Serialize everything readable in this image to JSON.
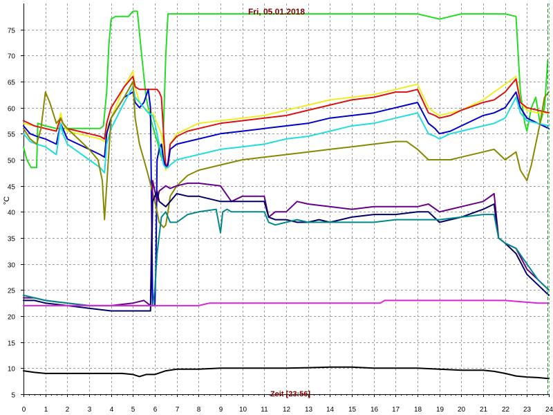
{
  "chart_data": {
    "type": "line",
    "title": "Fri, 05.01.2018",
    "xlabel": "Zeit [23:56]",
    "ylabel": "°C",
    "xlim": [
      0,
      24
    ],
    "ylim": [
      5,
      80
    ],
    "xticks": [
      0,
      1,
      2,
      3,
      4,
      5,
      6,
      7,
      8,
      9,
      10,
      11,
      12,
      13,
      14,
      15,
      16,
      17,
      18,
      19,
      20,
      21,
      22,
      23,
      24
    ],
    "yticks": [
      5,
      10,
      15,
      20,
      25,
      30,
      35,
      40,
      45,
      50,
      55,
      60,
      65,
      70,
      75
    ],
    "grid": true,
    "now_marker_x": 23.93,
    "series": [
      {
        "color": "#22dd22",
        "x": [
          0,
          0.15,
          0.35,
          0.6,
          0.65,
          1.0,
          1.5,
          2.0,
          2.5,
          3.0,
          3.5,
          3.65,
          3.8,
          3.9,
          4.0,
          4.2,
          4.5,
          4.8,
          5.0,
          5.1,
          5.2,
          5.4,
          5.6,
          5.8,
          6.0,
          6.15,
          6.25,
          6.35,
          6.5,
          6.6,
          6.7,
          7.0,
          7.5,
          8.0,
          9.0,
          10.0,
          11.0,
          12.0,
          13.0,
          14.0,
          15.0,
          16.0,
          17.0,
          18.0,
          18.5,
          19.0,
          19.5,
          20.0,
          21.0,
          22.0,
          22.5,
          22.7,
          22.9,
          23.0,
          23.2,
          23.4,
          23.6,
          23.8,
          23.95
        ],
        "y": [
          52.5,
          50,
          48.5,
          48.5,
          57,
          56.5,
          56,
          56,
          56,
          56,
          56,
          56.5,
          63,
          72,
          77,
          77.5,
          77.5,
          77.5,
          78.5,
          78.5,
          78.5,
          70,
          62,
          58,
          55,
          53,
          51,
          50,
          70,
          78,
          78,
          78,
          78,
          78,
          78,
          78,
          78,
          78,
          78,
          78,
          78,
          78,
          78,
          78,
          77.5,
          77,
          77.5,
          78,
          78,
          78,
          77.5,
          63,
          57,
          55.5,
          60,
          62,
          57,
          60,
          69
        ]
      },
      {
        "color": "#eeee22",
        "x": [
          0,
          0.5,
          1.0,
          1.5,
          1.7,
          1.8,
          2.0,
          2.5,
          3.0,
          3.5,
          3.7,
          3.8,
          4.0,
          4.3,
          4.6,
          5.0,
          5.1,
          5.3,
          5.5,
          5.7,
          5.9,
          6.0,
          6.1,
          6.2,
          6.3,
          6.4,
          6.5,
          6.6,
          6.7,
          7.0,
          7.5,
          8.0,
          9.0,
          10.0,
          11.0,
          12.0,
          13.0,
          14.0,
          15.0,
          16.0,
          17.0,
          17.5,
          18.0,
          18.5,
          18.8,
          19.0,
          19.5,
          20.0,
          21.0,
          21.5,
          22.0,
          22.5,
          22.7,
          23.0,
          23.5,
          24.0
        ],
        "y": [
          57,
          56.5,
          56,
          55.5,
          59,
          57,
          55.5,
          55,
          54.5,
          54,
          53.5,
          56,
          58,
          61,
          64,
          67,
          64,
          61,
          60,
          59.5,
          59,
          58,
          57,
          56,
          55,
          52,
          48,
          49,
          53,
          55,
          56,
          57,
          57.5,
          58,
          58.5,
          59.5,
          60.5,
          61.5,
          62,
          62.5,
          63.5,
          64,
          64.5,
          60,
          59,
          58.5,
          59,
          59.5,
          61.5,
          63,
          64.5,
          66,
          61,
          59.5,
          59,
          59
        ]
      },
      {
        "color": "#dd1111",
        "x": [
          0,
          0.5,
          1.0,
          1.5,
          1.7,
          1.8,
          2.0,
          2.5,
          3.0,
          3.5,
          3.7,
          3.8,
          4.0,
          4.3,
          4.6,
          5.0,
          5.1,
          5.3,
          5.5,
          5.7,
          5.9,
          6.0,
          6.1,
          6.2,
          6.3,
          6.4,
          6.5,
          6.6,
          6.7,
          7.0,
          7.5,
          8.0,
          9.0,
          10.0,
          11.0,
          12.0,
          13.0,
          14.0,
          15.0,
          16.0,
          17.0,
          17.5,
          18.0,
          18.5,
          18.8,
          19.0,
          19.5,
          20.0,
          21.0,
          21.5,
          22.0,
          22.5,
          22.7,
          23.0,
          23.5,
          24.0
        ],
        "y": [
          57.5,
          56.5,
          56,
          55.5,
          58,
          57,
          56,
          55.5,
          55,
          54.5,
          54,
          57,
          60,
          62,
          64,
          66,
          64,
          63.5,
          63.5,
          63.5,
          63.5,
          63.5,
          63.5,
          63,
          62,
          55,
          48.5,
          49.5,
          53,
          54.5,
          55.5,
          56,
          57,
          57.5,
          58,
          58.5,
          59.5,
          60.5,
          61.5,
          62,
          63,
          63,
          63.5,
          59,
          58.5,
          58,
          58.5,
          59.5,
          61,
          61.5,
          63,
          65.5,
          61,
          60,
          59.5,
          59
        ]
      },
      {
        "color": "#0000cc",
        "x": [
          0,
          0.3,
          0.6,
          1.0,
          1.5,
          1.7,
          1.8,
          2.0,
          2.5,
          3.0,
          3.5,
          3.7,
          3.8,
          4.0,
          4.3,
          4.6,
          5.0,
          5.1,
          5.3,
          5.5,
          5.7,
          5.8,
          5.85,
          5.9,
          6.0,
          6.05,
          6.1,
          6.2,
          6.3,
          6.4,
          6.5,
          6.6,
          6.7,
          7.0,
          7.5,
          8.0,
          9.0,
          10.0,
          11.0,
          12.0,
          13.0,
          14.0,
          15.0,
          16.0,
          17.0,
          17.5,
          18.0,
          18.5,
          18.8,
          19.0,
          19.5,
          20.0,
          21.0,
          21.5,
          22.0,
          22.5,
          22.7,
          23.0,
          23.5,
          24.0
        ],
        "y": [
          56.5,
          55,
          54.5,
          54,
          53,
          57,
          56,
          54,
          53,
          52,
          51,
          50.5,
          55,
          58,
          60,
          62,
          63,
          61,
          60,
          61,
          63.5,
          60,
          40,
          22,
          22,
          30,
          50,
          52,
          53,
          50,
          48.5,
          49,
          52,
          53,
          53.5,
          54,
          55,
          55.5,
          56,
          56.5,
          57,
          58,
          58.5,
          59,
          60,
          60.5,
          61,
          57,
          56,
          55,
          55.5,
          56.5,
          58.5,
          59,
          60,
          63,
          60,
          58,
          57,
          56
        ]
      },
      {
        "color": "#22dddd",
        "x": [
          0,
          0.3,
          0.6,
          1.0,
          1.5,
          1.7,
          1.8,
          2.0,
          2.5,
          3.0,
          3.5,
          3.7,
          3.8,
          4.0,
          4.3,
          4.6,
          5.0,
          5.1,
          5.3,
          5.5,
          5.7,
          5.9,
          6.0,
          6.2,
          6.4,
          6.5,
          6.6,
          6.7,
          7.0,
          7.5,
          8.0,
          9.0,
          10.0,
          11.0,
          12.0,
          13.0,
          14.0,
          15.0,
          16.0,
          17.0,
          17.5,
          18.0,
          18.5,
          18.8,
          19.0,
          19.5,
          20.0,
          21.0,
          21.5,
          22.0,
          22.5,
          22.7,
          23.0,
          23.5,
          24.0
        ],
        "y": [
          55,
          53.5,
          53,
          52.5,
          51,
          57,
          55,
          53,
          51.5,
          50,
          48.5,
          47.5,
          53,
          56,
          58.5,
          61,
          64,
          62,
          61,
          60,
          59,
          58.5,
          57,
          53,
          49,
          48.5,
          48.5,
          49,
          50,
          50.5,
          51,
          52,
          52.5,
          53,
          54,
          54.5,
          55.5,
          56.5,
          57,
          58,
          58.5,
          59,
          55,
          54.5,
          54,
          55,
          55.5,
          56.5,
          57,
          58,
          62,
          59,
          57.5,
          57,
          56.5
        ]
      },
      {
        "color": "#888800",
        "x": [
          0,
          0.3,
          0.6,
          0.8,
          1.0,
          1.2,
          1.5,
          1.7,
          1.8,
          2.0,
          2.5,
          3.0,
          3.4,
          3.6,
          3.7,
          3.8,
          4.0,
          4.3,
          4.6,
          5.0,
          5.1,
          5.3,
          5.5,
          5.7,
          6.0,
          6.2,
          6.4,
          6.5,
          6.6,
          6.7,
          7.0,
          7.5,
          8.0,
          9.0,
          10.0,
          11.0,
          12.0,
          13.0,
          14.0,
          15.0,
          16.0,
          17.0,
          17.5,
          18.0,
          18.5,
          19.0,
          19.5,
          20.0,
          21.0,
          21.5,
          22.0,
          22.5,
          22.7,
          23.0,
          23.2,
          23.4,
          23.6,
          23.8,
          24.0
        ],
        "y": [
          56,
          54,
          53,
          56,
          63,
          61,
          57,
          58,
          57,
          56,
          54,
          52,
          50,
          46,
          38.5,
          45,
          58,
          60,
          62,
          65,
          58,
          53,
          50,
          47,
          42,
          38,
          37,
          37.5,
          40,
          43,
          45,
          47,
          48,
          49,
          50,
          50.5,
          51,
          51.5,
          52,
          52.5,
          53,
          53.5,
          53.5,
          52,
          50,
          50,
          50,
          50.5,
          51.5,
          52,
          50,
          51.5,
          48,
          46,
          49,
          53,
          57,
          62,
          63
        ]
      },
      {
        "color": "#660088",
        "x": [
          0,
          0.5,
          1.0,
          2.0,
          3.0,
          4.0,
          5.0,
          5.5,
          5.8,
          5.85,
          5.9,
          6.0,
          6.1,
          6.2,
          6.5,
          6.7,
          7.0,
          7.5,
          8.0,
          9.0,
          9.5,
          10.0,
          11.0,
          11.2,
          11.5,
          12.0,
          12.5,
          13.0,
          14.0,
          15.0,
          16.0,
          17.0,
          18.0,
          18.5,
          19.0,
          19.5,
          20.0,
          21.0,
          21.5,
          21.7,
          22.0,
          22.5,
          23.0,
          23.5,
          24.0
        ],
        "y": [
          23.5,
          23.5,
          23,
          22.5,
          22,
          22,
          22.5,
          23,
          22,
          35,
          46,
          44,
          42,
          44,
          45,
          44.5,
          45,
          45.5,
          45.5,
          45,
          42,
          43,
          43,
          39,
          40,
          40,
          42,
          41.5,
          41,
          40.5,
          41,
          41,
          41,
          41.5,
          40,
          40.5,
          41,
          42,
          43.5,
          35,
          34,
          33,
          29,
          27,
          25
        ]
      },
      {
        "color": "#000066",
        "x": [
          0,
          0.5,
          1.0,
          2.0,
          3.0,
          4.0,
          5.0,
          5.5,
          5.8,
          5.85,
          5.9,
          6.0,
          6.1,
          6.2,
          6.5,
          6.7,
          7.0,
          7.5,
          8.0,
          9.0,
          9.5,
          10.0,
          11.0,
          11.2,
          11.5,
          12.0,
          12.5,
          13.0,
          13.5,
          14.0,
          15.0,
          16.0,
          17.0,
          18.0,
          18.5,
          19.0,
          19.5,
          20.0,
          21.0,
          21.5,
          21.7,
          22.0,
          22.5,
          23.0,
          23.5,
          24.0
        ],
        "y": [
          23,
          23,
          22.5,
          22,
          21.5,
          21,
          21,
          21,
          21,
          30,
          42,
          43,
          44,
          42,
          41,
          42,
          43.5,
          43,
          43,
          42,
          42,
          42,
          42,
          39,
          38.5,
          38.5,
          38,
          38,
          38.5,
          38,
          39,
          39.5,
          39.5,
          40,
          40,
          38,
          38.5,
          39,
          40.5,
          41.5,
          35,
          34,
          32,
          28,
          26,
          24
        ]
      },
      {
        "color": "#008888",
        "x": [
          0,
          0.5,
          1.0,
          2.0,
          3.0,
          4.0,
          5.0,
          5.5,
          5.8,
          5.9,
          6.0,
          6.1,
          6.3,
          6.5,
          6.7,
          7.0,
          7.5,
          8.0,
          8.8,
          9.0,
          9.1,
          9.3,
          9.5,
          10.0,
          11.0,
          11.2,
          11.5,
          12.0,
          12.5,
          13.0,
          14.0,
          15.0,
          16.0,
          17.0,
          18.0,
          19.0,
          20.0,
          21.0,
          21.5,
          21.7,
          22.0,
          22.5,
          23.0,
          23.5,
          24.0
        ],
        "y": [
          24,
          23.5,
          23,
          22.5,
          22,
          22,
          22,
          22,
          22,
          22,
          25,
          32,
          39,
          40,
          38,
          38,
          39.5,
          40,
          40.5,
          36,
          40,
          40.5,
          40,
          40,
          40,
          38,
          37.5,
          38,
          38.5,
          38,
          38,
          38,
          38,
          38.5,
          38.5,
          38.5,
          39,
          39.5,
          39.5,
          35,
          34,
          33,
          30,
          27,
          25
        ]
      },
      {
        "color": "#dd22dd",
        "x": [
          0,
          6.0,
          8.0,
          8.5,
          9.0,
          10.0,
          12.0,
          14.0,
          15.0,
          16.0,
          16.3,
          16.5,
          17.0,
          18.0,
          20.0,
          22.0,
          23.5,
          24.0
        ],
        "y": [
          22,
          22,
          22,
          22.5,
          22.5,
          22.5,
          22.5,
          22.5,
          22.5,
          22.5,
          22.5,
          23,
          23,
          23,
          23,
          23,
          22.5,
          22.5
        ]
      },
      {
        "color": "#000000",
        "x": [
          0,
          0.5,
          1.0,
          2.0,
          3.0,
          4.0,
          4.5,
          5.0,
          5.3,
          5.6,
          6.0,
          6.5,
          7.0,
          8.0,
          9.0,
          10.0,
          11.0,
          12.0,
          13.0,
          14.0,
          15.0,
          16.0,
          17.0,
          18.0,
          19.0,
          20.0,
          21.0,
          21.5,
          22.0,
          22.5,
          23.0,
          23.5,
          24.0
        ],
        "y": [
          9.5,
          9.2,
          9.0,
          9.0,
          9.0,
          9.0,
          9.0,
          8.8,
          8.4,
          8.8,
          8.8,
          9.5,
          9.8,
          9.8,
          10.0,
          10.0,
          10.0,
          10.0,
          10.1,
          10.2,
          10.2,
          10.0,
          10.0,
          10.0,
          9.8,
          9.6,
          9.6,
          9.4,
          9.0,
          8.5,
          8.3,
          8.2,
          8.0
        ]
      }
    ]
  }
}
